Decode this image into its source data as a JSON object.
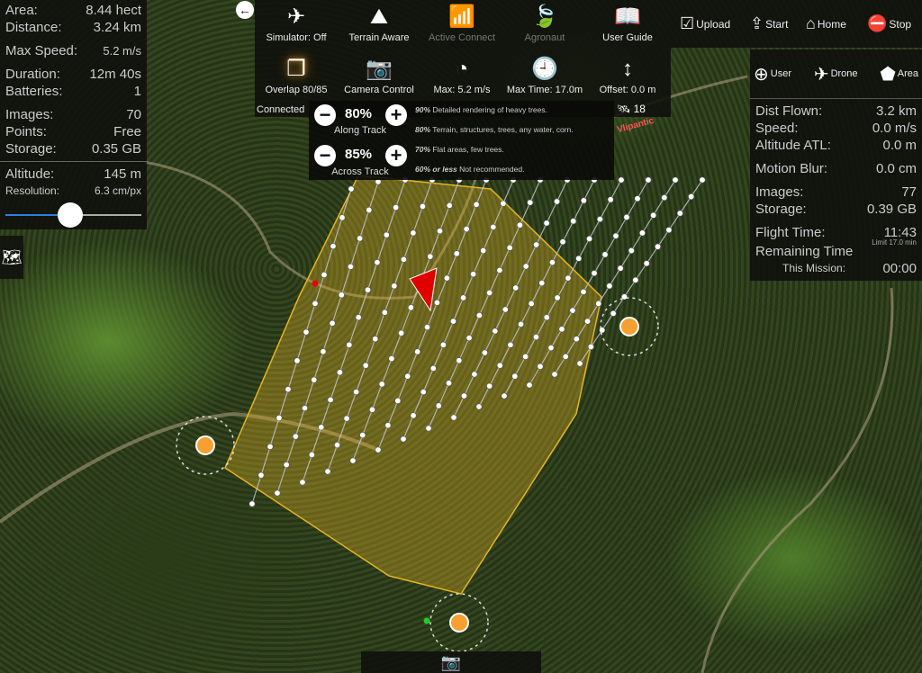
{
  "left_panel": {
    "rows": [
      {
        "label": "Area:",
        "value": "8.44 hect"
      },
      {
        "label": "Distance:",
        "value": "3.24 km"
      },
      {
        "label": "Max Speed:",
        "value": "5.2 m/s"
      },
      {
        "label": "Duration:",
        "value": "12m 40s"
      },
      {
        "label": "Batteries:",
        "value": "1"
      },
      {
        "label": "Images:",
        "value": "70"
      },
      {
        "label": "Points:",
        "value": "Free"
      },
      {
        "label": "Storage:",
        "value": "0.35 GB"
      }
    ],
    "altitude": {
      "label": "Altitude:",
      "value": "145 m"
    },
    "resolution": {
      "label": "Resolution:",
      "value": "6.3 cm/px"
    },
    "altitude_slider_fraction": 0.48
  },
  "toolbar": {
    "row1": [
      {
        "icon": "airplane-icon",
        "label": "Simulator: Off"
      },
      {
        "icon": "mountain-icon",
        "label": "Terrain Aware"
      },
      {
        "icon": "antenna-icon",
        "label": "Active Connect"
      },
      {
        "icon": "leaf-icon",
        "label": "Agronaut"
      },
      {
        "icon": "book-icon",
        "label": "User Guide"
      }
    ],
    "row2": [
      {
        "icon": "layers-icon",
        "label": "Overlap 80/85"
      },
      {
        "icon": "camera-icon",
        "label": "Camera Control"
      },
      {
        "icon": "speedometer-icon",
        "label": "Max: 5.2 m/s"
      },
      {
        "icon": "clock-icon",
        "label": "Max Time: 17.0m"
      },
      {
        "icon": "up-down-arrow-icon",
        "label": "Offset: 0.0 m"
      }
    ],
    "status": "Connected",
    "satellites": "18"
  },
  "overlap_popup": {
    "along": {
      "value": "80%",
      "label": "Along Track"
    },
    "across": {
      "value": "85%",
      "label": "Across Track"
    },
    "notes": [
      {
        "pct": "90%",
        "text": "Detailed rendering of heavy trees."
      },
      {
        "pct": "80%",
        "text": "Terrain, structures, trees, any water, corn."
      },
      {
        "pct": "70%",
        "text": "Flat areas, few trees."
      },
      {
        "pct": "60% or less",
        "text": "Not recommended."
      }
    ]
  },
  "actions": [
    {
      "icon": "checkbox-icon",
      "label": "Upload"
    },
    {
      "icon": "upload-arrow-icon",
      "label": "Start"
    },
    {
      "icon": "home-icon",
      "label": "Home"
    },
    {
      "icon": "stop-sign-icon",
      "label": "Stop"
    }
  ],
  "right_panel": {
    "center": [
      {
        "icon": "crosshair-icon",
        "label": "User"
      },
      {
        "icon": "airplane-icon",
        "label": "Drone"
      },
      {
        "icon": "pentagon-icon",
        "label": "Area"
      }
    ],
    "rows": [
      {
        "label": "Dist Flown:",
        "value": "3.2 km"
      },
      {
        "label": "Speed:",
        "value": "0.0 m/s"
      },
      {
        "label": "Altitude ATL:",
        "value": "0.0 m"
      },
      {
        "label": "Motion Blur:",
        "value": "0.0 cm"
      },
      {
        "label": "Images:",
        "value": "77"
      },
      {
        "label": "Storage:",
        "value": "0.39 GB"
      },
      {
        "label": "Flight Time:",
        "value": "11:43"
      }
    ],
    "limit": "Limit 17.0 min",
    "remaining_label": "Remaining Time",
    "mission_label": "This Mission:",
    "mission_value": "00:00"
  },
  "map": {
    "town": "Vlipantic",
    "polygon_color": "#e6b422",
    "drone_color": "#e00000",
    "marker_color": "#f5a030"
  }
}
